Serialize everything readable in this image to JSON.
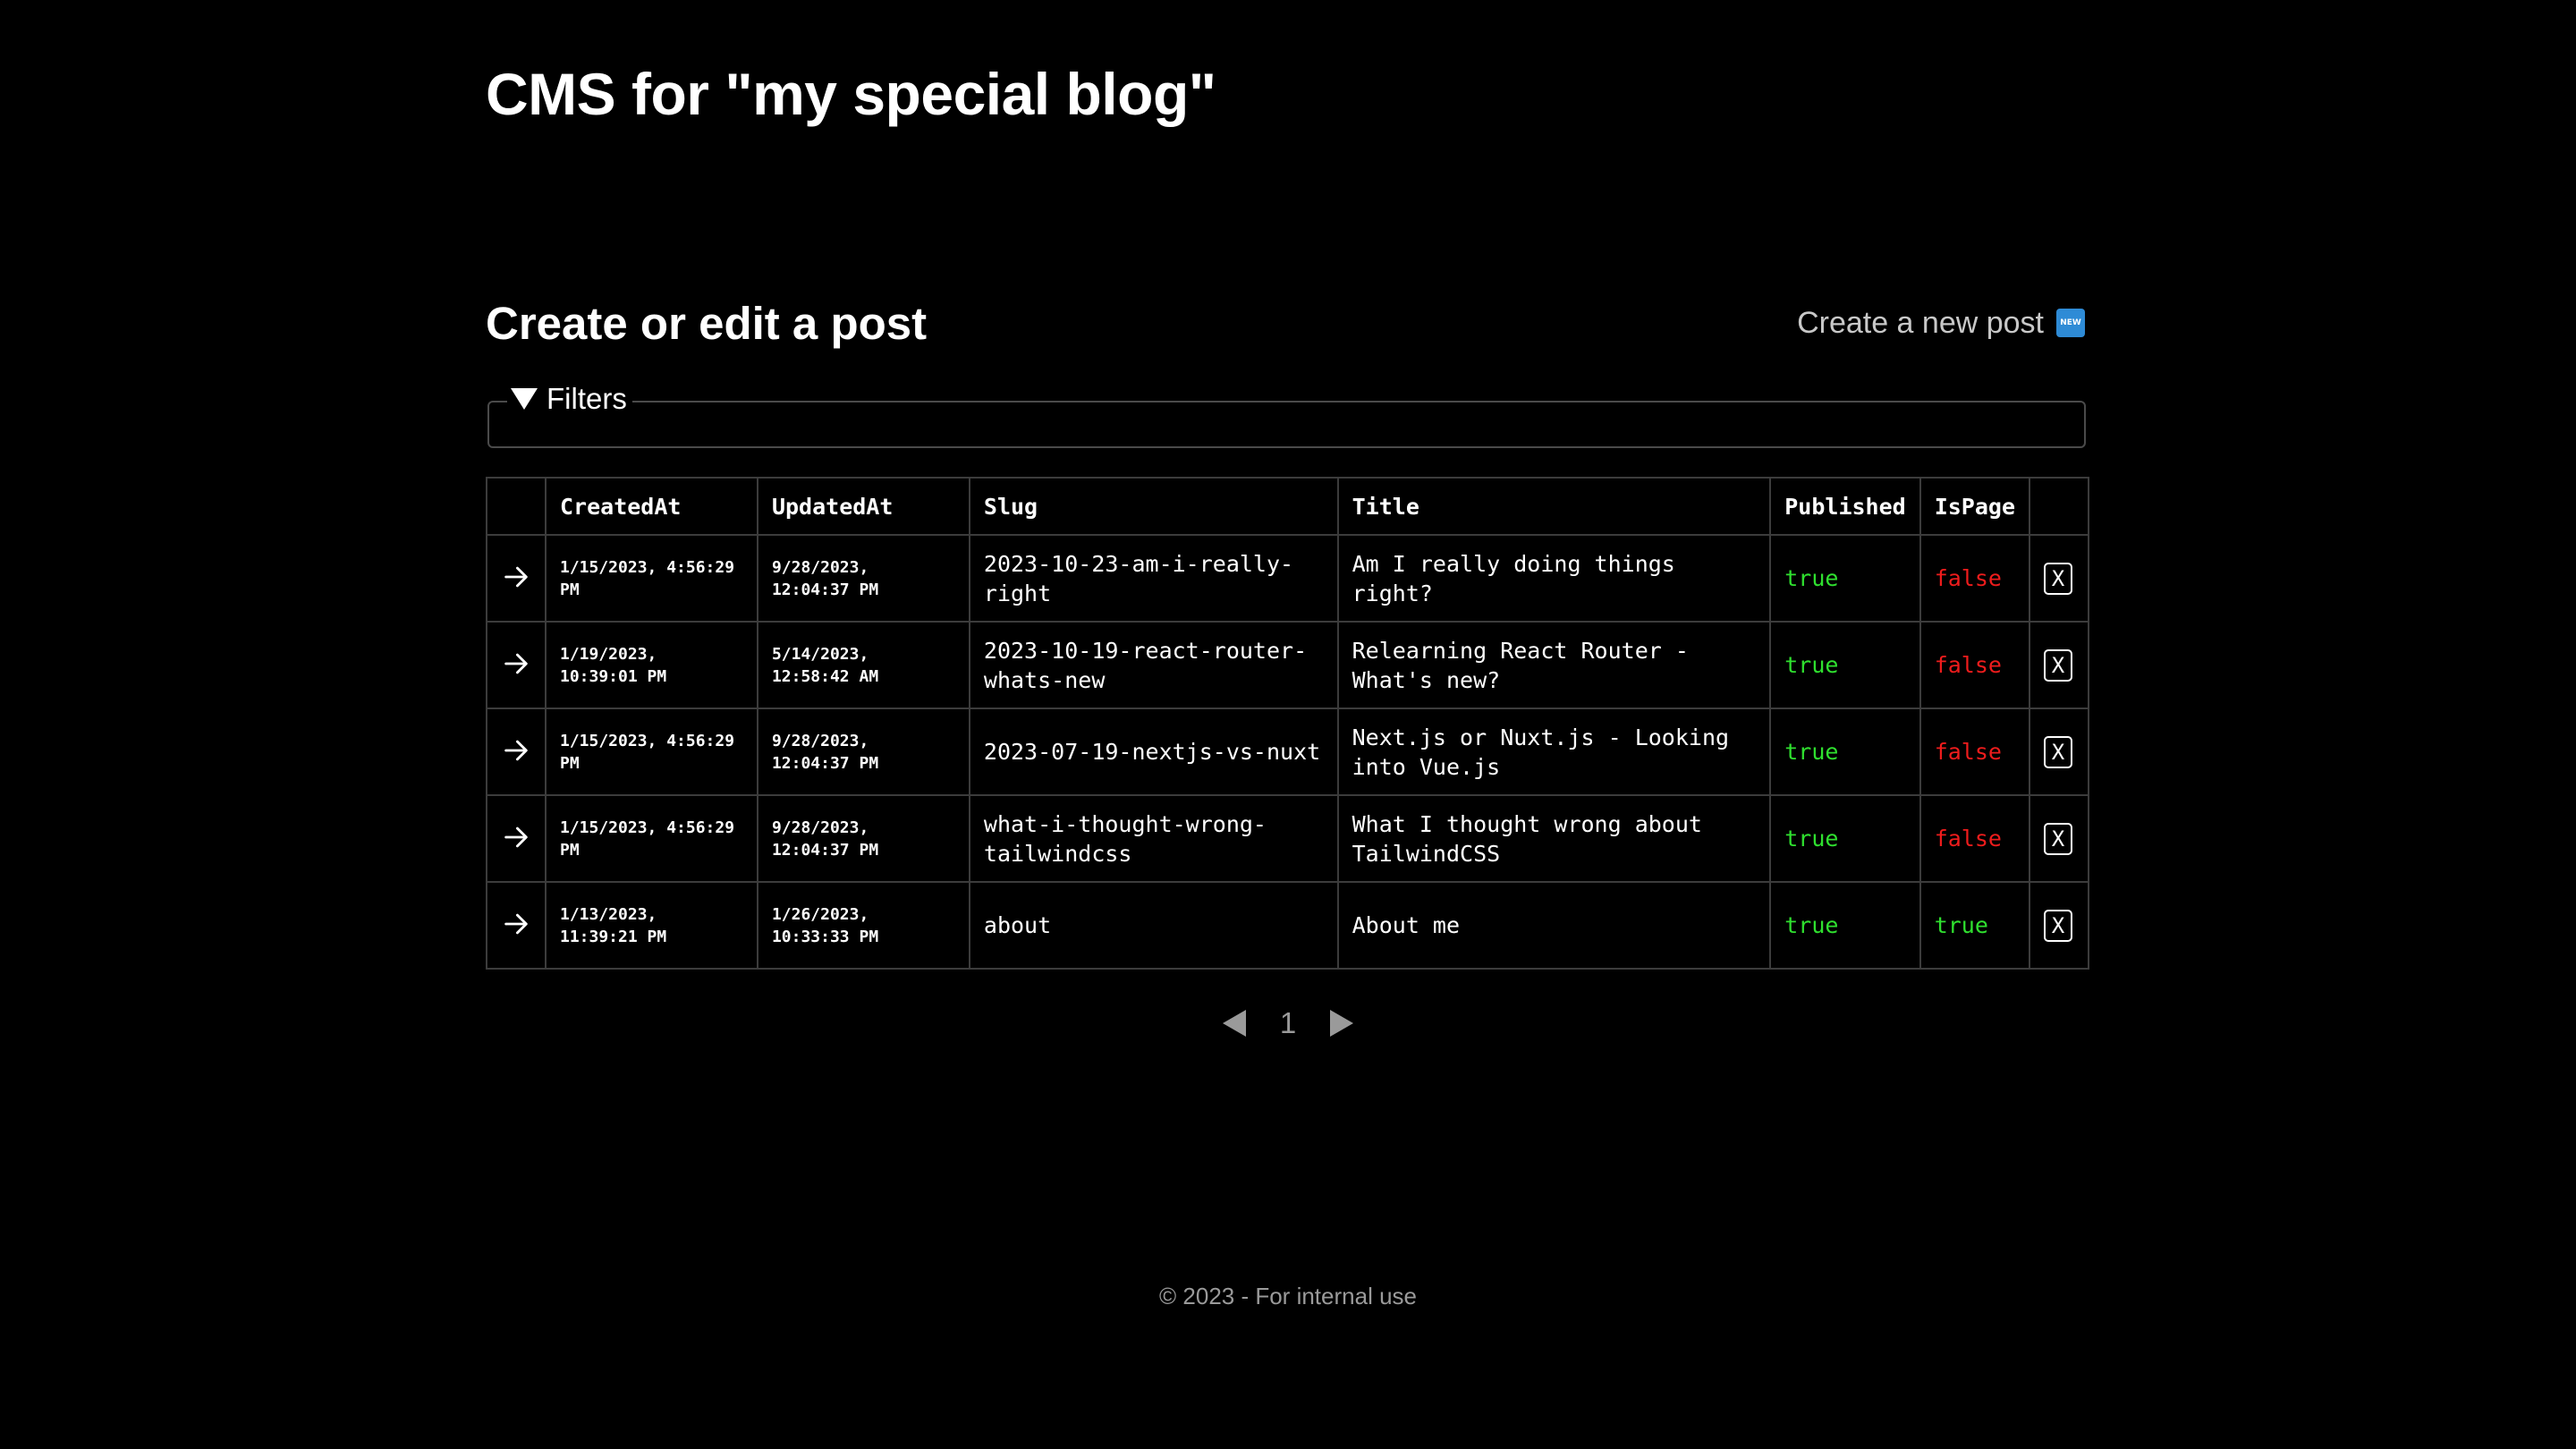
{
  "header": {
    "title": "CMS for \"my special blog\""
  },
  "section": {
    "title": "Create or edit a post",
    "new_post_label": "Create a new post",
    "new_badge": "NEW"
  },
  "filters": {
    "label": "Filters"
  },
  "table": {
    "headers": [
      "",
      "CreatedAt",
      "UpdatedAt",
      "Slug",
      "Title",
      "Published",
      "IsPage",
      ""
    ],
    "rows": [
      {
        "created": "1/15/2023, 4:56:29 PM",
        "updated": "9/28/2023, 12:04:37 PM",
        "slug": "2023-10-23-am-i-really-right",
        "title": "Am I really doing things right?",
        "published": "true",
        "is_page": "false",
        "delete_label": "X"
      },
      {
        "created": "1/19/2023, 10:39:01 PM",
        "updated": "5/14/2023, 12:58:42 AM",
        "slug": "2023-10-19-react-router-whats-new",
        "title": "Relearning React Router - What's new?",
        "published": "true",
        "is_page": "false",
        "delete_label": "X"
      },
      {
        "created": "1/15/2023, 4:56:29 PM",
        "updated": "9/28/2023, 12:04:37 PM",
        "slug": "2023-07-19-nextjs-vs-nuxt",
        "title": "Next.js or Nuxt.js - Looking into Vue.js",
        "published": "true",
        "is_page": "false",
        "delete_label": "X"
      },
      {
        "created": "1/15/2023, 4:56:29 PM",
        "updated": "9/28/2023, 12:04:37 PM",
        "slug": "what-i-thought-wrong-tailwindcss",
        "title": "What I thought wrong about TailwindCSS",
        "published": "true",
        "is_page": "false",
        "delete_label": "X"
      },
      {
        "created": "1/13/2023, 11:39:21 PM",
        "updated": "1/26/2023, 10:33:33 PM",
        "slug": "about",
        "title": "About me",
        "published": "true",
        "is_page": "true",
        "delete_label": "X"
      }
    ]
  },
  "pagination": {
    "current_page": "1"
  },
  "footer": {
    "text": "© 2023 - For internal use"
  },
  "colors": {
    "true": "#2fe02f",
    "false": "#ee1c1c",
    "badge": "#2e8bd6"
  },
  "icons": {
    "row_open": "arrow-right-icon",
    "prev": "triangle-left-icon",
    "next": "triangle-right-icon",
    "filters_toggle": "triangle-down-icon",
    "new_badge": "new-badge-icon"
  }
}
